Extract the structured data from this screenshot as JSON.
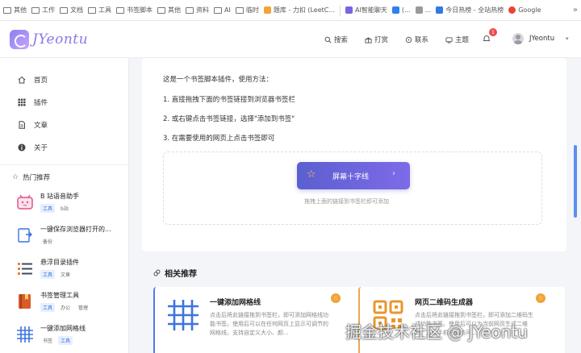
{
  "bookmarks": [
    {
      "label": "其他",
      "icon": "folder-icon"
    },
    {
      "label": "工作",
      "icon": "folder-icon"
    },
    {
      "label": "文档",
      "icon": "folder-icon"
    },
    {
      "label": "工具",
      "icon": "folder-icon"
    },
    {
      "label": "书签脚本",
      "icon": "folder-icon"
    },
    {
      "label": "其他",
      "icon": "folder-icon"
    },
    {
      "label": "资料",
      "icon": "folder-icon"
    },
    {
      "label": "AI",
      "icon": "folder-icon"
    },
    {
      "label": "临时",
      "icon": "folder-icon"
    },
    {
      "label": "题库 - 力扣 (LeetC...",
      "icon": "site-icon"
    },
    {
      "label": "AI智能聊天",
      "icon": "site-icon"
    },
    {
      "label": "(...",
      "icon": "site-icon"
    },
    {
      "label": "...",
      "icon": "site-icon"
    },
    {
      "label": "今日热榜 - 全站热榜",
      "icon": "site-icon"
    },
    {
      "label": "Google",
      "icon": "site-icon"
    }
  ],
  "header": {
    "logo_text": "JYeontu",
    "nav": [
      {
        "label": "搜索",
        "icon": "search-icon"
      },
      {
        "label": "打赏",
        "icon": "gift-icon"
      },
      {
        "label": "联系",
        "icon": "contact-icon"
      },
      {
        "label": "主题",
        "icon": "theme-icon"
      }
    ],
    "notification_count": "1",
    "user_name": "JYeontu"
  },
  "sidebar": {
    "nav": [
      {
        "label": "首页",
        "icon": "home-icon"
      },
      {
        "label": "插件",
        "icon": "grid-icon"
      },
      {
        "label": "文章",
        "icon": "document-icon"
      },
      {
        "label": "关于",
        "icon": "info-icon"
      }
    ],
    "hot_title": "热门推荐",
    "hot_items": [
      {
        "name": "B 站语音助手",
        "tags": [
          "工具",
          "b站"
        ]
      },
      {
        "name": "一键保存浏览器打开的...",
        "tags": [
          "备份"
        ]
      },
      {
        "name": "悬浮目录插件",
        "tags": [
          "工具",
          "文章"
        ]
      },
      {
        "name": "书签管理工具",
        "tags": [
          "工具",
          "办公",
          "管理"
        ]
      },
      {
        "name": "一键添加网格线",
        "tags": [
          "书签",
          "工具"
        ]
      }
    ]
  },
  "content": {
    "intro": "这是一个书签脚本插件，使用方法：",
    "steps": [
      "1. 直接拖拽下面的书签链接到浏览器书签栏",
      "2. 或右键点击书签链接，选择\"添加到书签\"",
      "3. 在需要使用的网页上点击书签即可"
    ],
    "bookmark_button_label": "屏幕十字线",
    "drag_hint": "拖拽上面的链接到书签栏即可添加"
  },
  "related": {
    "title": "相关推荐",
    "cards": [
      {
        "title": "一键添加网格线",
        "desc": "点击后将此链接拖到书签栏，即可添加网格线功能书签。使用后可以在任何网页上显示可调节的网格线，支持自定义大小、颜...",
        "badge": "☆"
      },
      {
        "title": "网页二维码生成器",
        "desc": "点击后将此链接拖到书签栏，即可添加二维码生成功能书签。使用后可以为当前网页生成二维码，方便手机扫码访问...",
        "badge": "☆"
      }
    ]
  },
  "watermark": "掘金技术社区 @ JYeontu",
  "colors": {
    "accent": "#6a66dc",
    "brand": "#8a79e6",
    "badge": "#f04b4b",
    "link_blue": "#3e74e0"
  }
}
